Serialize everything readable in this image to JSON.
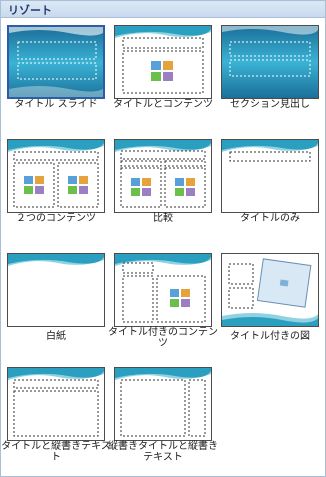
{
  "gallery": {
    "title": "リゾート",
    "layouts": [
      {
        "label": "タイトル スライド",
        "type": "title-slide",
        "selected": true
      },
      {
        "label": "タイトルとコンテンツ",
        "type": "title-content"
      },
      {
        "label": "セクション見出し",
        "type": "section-header"
      },
      {
        "label": "２つのコンテンツ",
        "type": "two-content"
      },
      {
        "label": "比較",
        "type": "comparison"
      },
      {
        "label": "タイトルのみ",
        "type": "title-only"
      },
      {
        "label": "白紙",
        "type": "blank"
      },
      {
        "label": "タイトル付きのコンテンツ",
        "type": "content-caption"
      },
      {
        "label": "タイトル付きの図",
        "type": "picture-caption"
      },
      {
        "label": "タイトルと縦書きテキスト",
        "type": "title-vertical-text"
      },
      {
        "label": "縦書きタイトルと縦書きテキスト",
        "type": "vertical-title-text"
      }
    ]
  },
  "colors": {
    "accent": "#2b5ea7",
    "wave_light": "#8fd3e3",
    "wave_dark": "#2a9fc0",
    "dark_bg": "#1d7fa6"
  }
}
